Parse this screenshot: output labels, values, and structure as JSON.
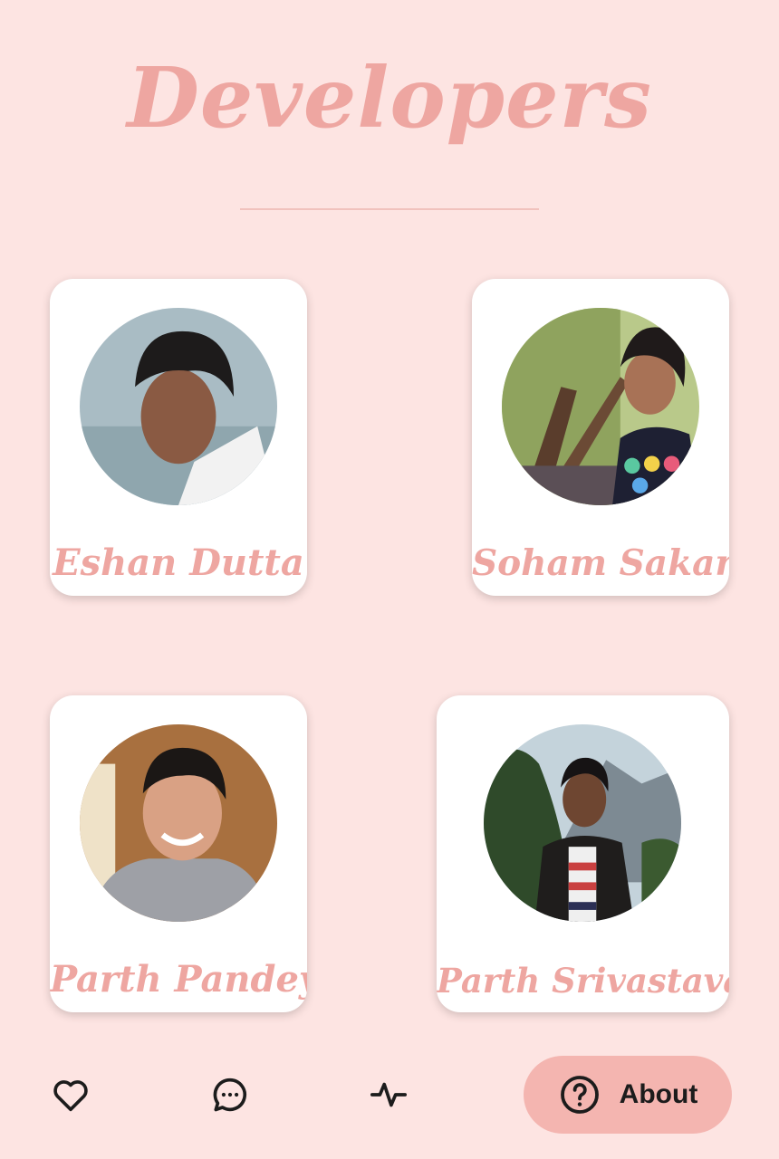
{
  "header": {
    "title": "Developers"
  },
  "developers": [
    {
      "name": "Eshan Dutta"
    },
    {
      "name": "Soham Sakaria"
    },
    {
      "name": "Parth Pandey"
    },
    {
      "name": "Parth Srivastava"
    }
  ],
  "bottom_nav": {
    "items": [
      {
        "icon": "heart-icon"
      },
      {
        "icon": "chat-bubble-icon"
      },
      {
        "icon": "activity-icon"
      }
    ],
    "about": {
      "icon": "help-circle-icon",
      "label": "About"
    }
  },
  "colors": {
    "background": "#fde4e2",
    "accent": "#eea6a1",
    "active_pill": "#f4b5b0",
    "card": "#ffffff"
  }
}
